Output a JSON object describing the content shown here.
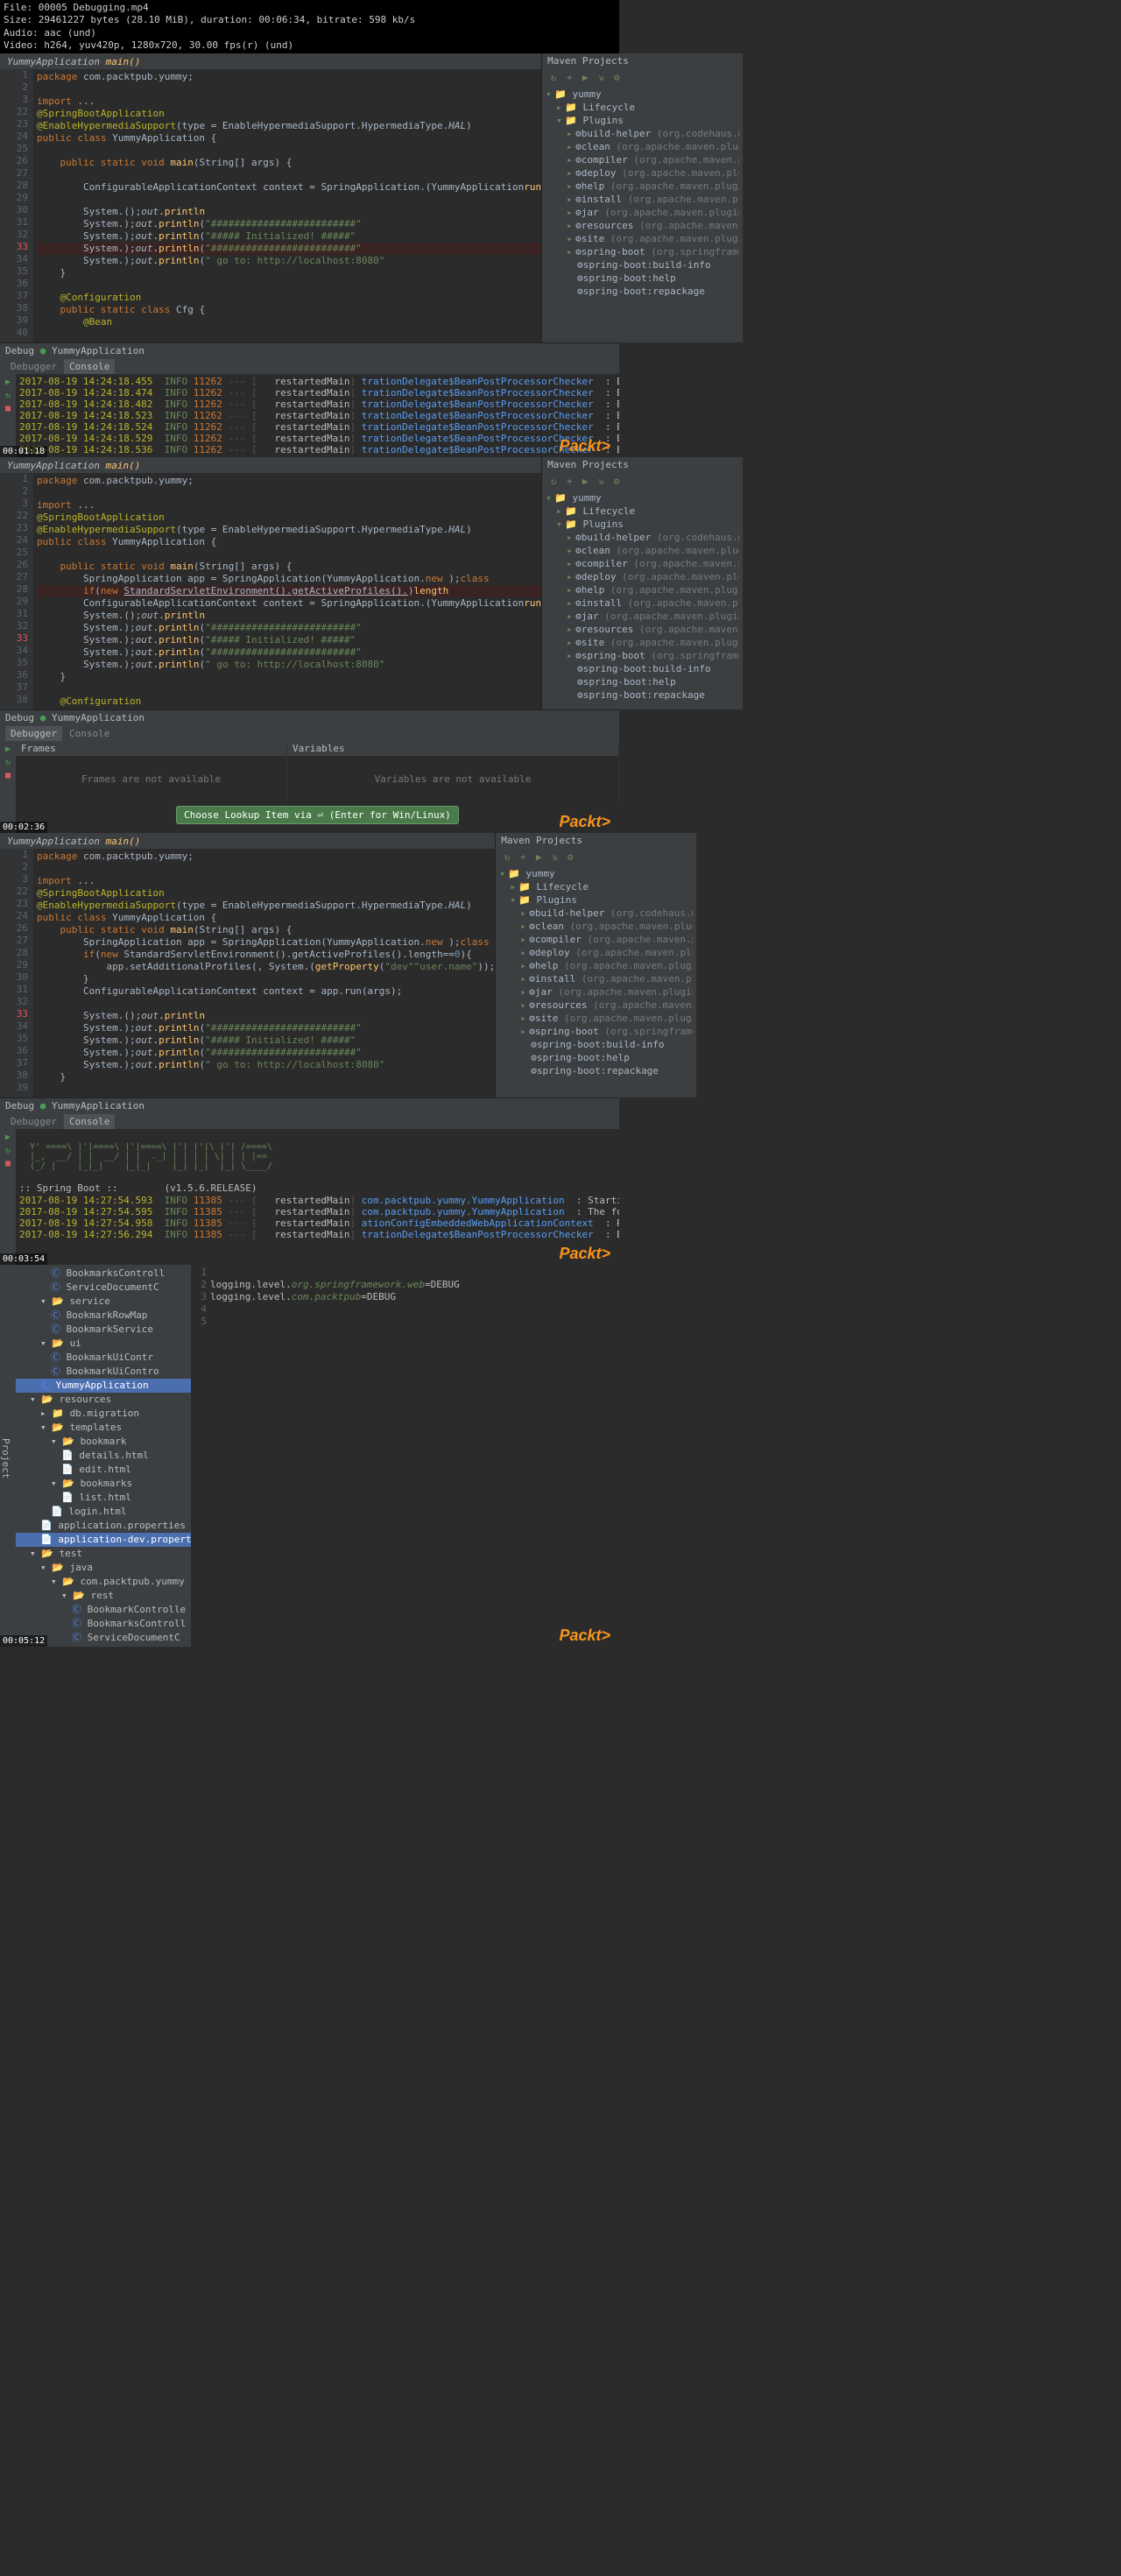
{
  "file_info": {
    "file": "File: 00005 Debugging.mp4",
    "size": "Size: 29461227 bytes (28.10 MiB), duration: 00:06:34, bitrate: 598 kb/s",
    "audio": "Audio: aac (und)",
    "video": "Video: h264, yuv420p, 1280x720, 30.00 fps(r) (und)"
  },
  "tab": {
    "class": "YummyApplication",
    "method": "main()"
  },
  "maven_title": "Maven Projects",
  "maven_tree": {
    "root": "yummy",
    "lifecycle": "Lifecycle",
    "plugins": "Plugins",
    "items": [
      {
        "n": "build-helper",
        "d": " (org.codehaus.mojo:b"
      },
      {
        "n": "clean",
        "d": " (org.apache.maven.plugins:"
      },
      {
        "n": "compiler",
        "d": " (org.apache.maven.plug"
      },
      {
        "n": "deploy",
        "d": " (org.apache.maven.plugins"
      },
      {
        "n": "help",
        "d": " (org.apache.maven.plugins:m"
      },
      {
        "n": "install",
        "d": " (org.apache.maven.plugins"
      },
      {
        "n": "jar",
        "d": " (org.apache.maven.plugins:ma"
      },
      {
        "n": "resources",
        "d": " (org.apache.maven.plu"
      },
      {
        "n": "site",
        "d": " (org.apache.maven.plugins:m"
      },
      {
        "n": "spring-boot",
        "d": " (org.springframework"
      }
    ],
    "sb_items": [
      "spring-boot:build-info",
      "spring-boot:help",
      "spring-boot:repackage"
    ]
  },
  "code1": [
    {
      "g": "1",
      "t": "package ",
      "kw": true,
      "r": "com.packtpub.yummy;"
    },
    {
      "g": "2",
      "t": ""
    },
    {
      "g": "3",
      "t": "import ",
      "kw": true,
      "r": "..."
    },
    {
      "g": "22",
      "t": "@SpringBootApplication",
      "ann": true
    },
    {
      "g": "23",
      "t": "@EnableHypermediaSupport",
      "ann": true,
      "r": "(type = EnableHypermediaSupport.HypermediaType.",
      "r2": "HAL",
      "r3": ")"
    },
    {
      "g": "24",
      "t": "public class ",
      "kw": true,
      "r": "YummyApplication {"
    },
    {
      "g": "25",
      "t": ""
    },
    {
      "g": "26",
      "t": "    public static void ",
      "kw": true,
      "m": "main",
      "r": "(String[] args) {"
    },
    {
      "g": "27",
      "t": ""
    },
    {
      "g": "28",
      "t": "        ConfigurableApplicationContext context = SpringApplication.",
      "m": "run",
      "r": "(YummyApplication"
    },
    {
      "g": "29",
      "t": ""
    },
    {
      "g": "30",
      "t": "        System.",
      "s": "out",
      "m": ".println",
      "r": "();"
    },
    {
      "g": "31",
      "t": "        System.",
      "s": "out",
      "m": ".println",
      "str": "\"#########################\"",
      "r2": ");"
    },
    {
      "g": "32",
      "t": "        System.",
      "s": "out",
      "m": ".println",
      "str": "\"##### Initialized! #####\"",
      "r2": ");"
    },
    {
      "g": "33",
      "bp": true,
      "t": "        System.",
      "s": "out",
      "m": ".println",
      "str": "\"#########################\"",
      "r2": ");",
      "hl": true
    },
    {
      "g": "34",
      "t": "        System.",
      "s": "out",
      "m": ".println",
      "str": "\" go to: http://localhost:8080\"",
      "r2": ");"
    },
    {
      "g": "35",
      "t": "    }"
    },
    {
      "g": "36",
      "t": ""
    },
    {
      "g": "37",
      "t": "    @Configuration",
      "ann": true
    },
    {
      "g": "38",
      "t": "    public static class ",
      "kw": true,
      "r": "Cfg {"
    },
    {
      "g": "39",
      "t": "        @Bean",
      "ann": true
    },
    {
      "g": "40",
      "t": ""
    }
  ],
  "debug_title": "Debug",
  "debug_app": "YummyApplication",
  "console_tabs": {
    "debugger": "Debugger",
    "console": "Console"
  },
  "log1": [
    {
      "ts": "2017-08-19 14:24:18.455",
      "lvl": "INFO",
      "pid": "11262",
      "th": "restartedMain",
      "cls": "trationDelegate$BeanPostProcessorChecker",
      "msg": ": Bean 'org.springframework.s"
    },
    {
      "ts": "2017-08-19 14:24:18.474",
      "lvl": "INFO",
      "pid": "11262",
      "th": "restartedMain",
      "cls": "trationDelegate$BeanPostProcessorChecker",
      "msg": ": Bean 'org.springframework.t"
    },
    {
      "ts": "2017-08-19 14:24:18.482",
      "lvl": "INFO",
      "pid": "11262",
      "th": "restartedMain",
      "cls": "trationDelegate$BeanPostProcessorChecker",
      "msg": ": Bean 'yummyApplication.Cfg'"
    },
    {
      "ts": "2017-08-19 14:24:18.523",
      "lvl": "INFO",
      "pid": "11262",
      "th": "restartedMain",
      "cls": "trationDelegate$BeanPostProcessorChecker",
      "msg": ": Bean 'objectPostProcessor'"
    },
    {
      "ts": "2017-08-19 14:24:18.524",
      "lvl": "INFO",
      "pid": "11262",
      "th": "restartedMain",
      "cls": "trationDelegate$BeanPostProcessorChecker",
      "msg": ": Bean 'org.springframework.s"
    },
    {
      "ts": "2017-08-19 14:24:18.529",
      "lvl": "INFO",
      "pid": "11262",
      "th": "restartedMain",
      "cls": "trationDelegate$BeanPostProcessorChecker",
      "msg": ": Bean 'org.springframework.s"
    },
    {
      "ts": "2017-08-19 14:24:18.536",
      "lvl": "INFO",
      "pid": "11262",
      "th": "restartedMain",
      "cls": "trationDelegate$BeanPostProcessorChecker",
      "msg": ": Bean 'methodSecurityMetada"
    }
  ],
  "ts1": "00:01:18",
  "packt": "Packt>",
  "code2": [
    {
      "g": "1",
      "t": "package ",
      "kw": true,
      "r": "com.packtpub.yummy;"
    },
    {
      "g": "2",
      "t": ""
    },
    {
      "g": "3",
      "t": "import ",
      "kw": true,
      "r": "..."
    },
    {
      "g": "22",
      "t": "@SpringBootApplication",
      "ann": true
    },
    {
      "g": "23",
      "t": "@EnableHypermediaSupport",
      "ann": true,
      "r": "(type = EnableHypermediaSupport.HypermediaType.",
      "r2": "HAL",
      "r3": ")"
    },
    {
      "g": "24",
      "t": "public class ",
      "kw": true,
      "r": "YummyApplication {"
    },
    {
      "g": "25",
      "t": ""
    },
    {
      "g": "26",
      "t": "    public static void ",
      "kw": true,
      "m": "main",
      "r": "(String[] args) {"
    },
    {
      "g": "27",
      "t": "        SpringApplication app = ",
      "kw2": "new ",
      "r": "SpringApplication(YummyApplication.",
      "kw3": "class",
      "r2": ");"
    },
    {
      "g": "28",
      "t": "        ",
      "kw": "if",
      "r": "(",
      "kw2": "new ",
      "u": "StandardServletEnvironment().getActiveProfiles().",
      "m": "length",
      "hl": true,
      "r2": ")"
    },
    {
      "g": "29",
      "t": "        ConfigurableApplicationContext context = SpringApplication.",
      "m": "run",
      "r": "(YummyApplication"
    },
    {
      "g": "31",
      "t": "        System.",
      "s": "out",
      "m": ".println",
      "r": "();"
    },
    {
      "g": "32",
      "t": "        System.",
      "s": "out",
      "m": ".println",
      "str": "\"#########################\"",
      "r2": ");"
    },
    {
      "g": "33",
      "bp": true,
      "t": "        System.",
      "s": "out",
      "m": ".println",
      "str": "\"##### Initialized! #####\"",
      "r2": ");"
    },
    {
      "g": "34",
      "t": "        System.",
      "s": "out",
      "m": ".println",
      "str": "\"#########################\"",
      "r2": ");"
    },
    {
      "g": "35",
      "t": "        System.",
      "s": "out",
      "m": ".println",
      "str": "\" go to: http://localhost:8080\"",
      "r2": ");"
    },
    {
      "g": "36",
      "t": "    }"
    },
    {
      "g": "37",
      "t": ""
    },
    {
      "g": "38",
      "t": "    @Configuration",
      "ann": true
    }
  ],
  "frames_title": "Frames",
  "vars_title": "Variables",
  "frames_na": "Frames are not available",
  "vars_na": "Variables are not available",
  "lookup_popup": "Choose Lookup Item via ⏎ (Enter for Win/Linux)",
  "ts2": "00:02:36",
  "code3": [
    {
      "g": "1",
      "t": "package ",
      "kw": true,
      "r": "com.packtpub.yummy;"
    },
    {
      "g": "2",
      "t": ""
    },
    {
      "g": "3",
      "t": "import ",
      "kw": true,
      "r": "..."
    },
    {
      "g": "22",
      "t": "@SpringBootApplication",
      "ann": true
    },
    {
      "g": "23",
      "t": "@EnableHypermediaSupport",
      "ann": true,
      "r": "(type = EnableHypermediaSupport.HypermediaType.",
      "r2": "HAL",
      "r3": ")"
    },
    {
      "g": "24",
      "t": "public class ",
      "kw": true,
      "r": "YummyApplication {"
    },
    {
      "g": "26",
      "t": "    public static void ",
      "kw": true,
      "m": "main",
      "r": "(String[] args) {"
    },
    {
      "g": "27",
      "t": "        SpringApplication app = ",
      "kw2": "new ",
      "r": "SpringApplication(YummyApplication.",
      "kw3": "class",
      "r2": ");"
    },
    {
      "g": "28",
      "t": "        ",
      "kw": "if",
      "r": "(",
      "kw2": "new ",
      "r2": "StandardServletEnvironment().getActiveProfiles().length==",
      "num": "0",
      "r3": "){"
    },
    {
      "g": "29",
      "t": "            app.setAdditionalProfiles(",
      "str": "\"dev\"",
      "r": ", System.",
      "m": "getProperty",
      "r2": "(",
      "str2": "\"user.name\"",
      "r3": "));"
    },
    {
      "g": "30",
      "t": "        }"
    },
    {
      "g": "31",
      "t": "        ConfigurableApplicationContext context = app.run(args);"
    },
    {
      "g": "32",
      "t": ""
    },
    {
      "g": "33",
      "bp": true,
      "t": "        System.",
      "s": "out",
      "m": ".println",
      "r": "();"
    },
    {
      "g": "34",
      "t": "        System.",
      "s": "out",
      "m": ".println",
      "str": "\"#########################\"",
      "r2": ");"
    },
    {
      "g": "35",
      "t": "        System.",
      "s": "out",
      "m": ".println",
      "str": "\"##### Initialized! #####\"",
      "r2": ");"
    },
    {
      "g": "36",
      "t": "        System.",
      "s": "out",
      "m": ".println",
      "str": "\"#########################\"",
      "r2": ");"
    },
    {
      "g": "37",
      "t": "        System.",
      "s": "out",
      "m": ".println",
      "str": "\" go to: http://localhost:8080\"",
      "r2": ");"
    },
    {
      "g": "38",
      "t": "    }"
    },
    {
      "g": "39",
      "t": ""
    }
  ],
  "banner": ":: Spring Boot ::        (v1.5.6.RELEASE)",
  "log3": [
    {
      "ts": "2017-08-19 14:27:54.593",
      "lvl": "INFO",
      "pid": "11385",
      "th": "restartedMain",
      "cls": "com.packtpub.yummy.YummyApplication",
      "msg": ": Starting YummyApplication o"
    },
    {
      "ts": "2017-08-19 14:27:54.595",
      "lvl": "INFO",
      "pid": "11385",
      "th": "restartedMain",
      "cls": "com.packtpub.yummy.YummyApplication",
      "msg": ": The following profiles are"
    },
    {
      "ts": "2017-08-19 14:27:54.958",
      "lvl": "INFO",
      "pid": "11385",
      "th": "restartedMain",
      "cls": "ationConfigEmbeddedWebApplicationContext",
      "msg": ": Refreshing org.springframew"
    },
    {
      "ts": "2017-08-19 14:27:56.294",
      "lvl": "INFO",
      "pid": "11385",
      "th": "restartedMain",
      "cls": "trationDelegate$BeanPostProcessorChecker",
      "msg": ": Bean 'yummyApplication.Cfg'"
    }
  ],
  "ts3": "00:03:54",
  "project_title": "Project",
  "project_tree": [
    {
      "i": 3,
      "t": "BookmarksControll",
      "c": "cls"
    },
    {
      "i": 3,
      "t": "ServiceDocumentC",
      "c": "cls"
    },
    {
      "i": 2,
      "t": "service",
      "c": "open"
    },
    {
      "i": 3,
      "t": "BookmarkRowMap",
      "c": "cls"
    },
    {
      "i": 3,
      "t": "BookmarkService",
      "c": "cls"
    },
    {
      "i": 2,
      "t": "ui",
      "c": "open"
    },
    {
      "i": 3,
      "t": "BookmarkUiContr",
      "c": "cls"
    },
    {
      "i": 3,
      "t": "BookmarkUiContro",
      "c": "cls"
    },
    {
      "i": 2,
      "t": "YummyApplication",
      "c": "cls",
      "sel": true
    },
    {
      "i": 1,
      "t": "resources",
      "c": "open"
    },
    {
      "i": 2,
      "t": "db.migration",
      "c": "folder"
    },
    {
      "i": 2,
      "t": "templates",
      "c": "open"
    },
    {
      "i": 3,
      "t": "bookmark",
      "c": "open"
    },
    {
      "i": 4,
      "t": "details.html",
      "c": "file"
    },
    {
      "i": 4,
      "t": "edit.html",
      "c": "file"
    },
    {
      "i": 3,
      "t": "bookmarks",
      "c": "open"
    },
    {
      "i": 4,
      "t": "list.html",
      "c": "file"
    },
    {
      "i": 3,
      "t": "login.html",
      "c": "file"
    },
    {
      "i": 2,
      "t": "application.properties",
      "c": "file"
    },
    {
      "i": 2,
      "t": "application-dev.properties",
      "c": "file",
      "sel": true
    },
    {
      "i": 1,
      "t": "test",
      "c": "open"
    },
    {
      "i": 2,
      "t": "java",
      "c": "open"
    },
    {
      "i": 3,
      "t": "com.packtpub.yummy",
      "c": "open"
    },
    {
      "i": 4,
      "t": "rest",
      "c": "open"
    },
    {
      "i": 5,
      "t": "BookmarkControlle",
      "c": "cls"
    },
    {
      "i": 5,
      "t": "BookmarksControll",
      "c": "cls"
    },
    {
      "i": 5,
      "t": "ServiceDocumentC",
      "c": "cls"
    }
  ],
  "props": [
    {
      "g": "1",
      "t": ""
    },
    {
      "g": "2",
      "k": "logging.level.",
      "c": "org.springframework.web",
      "v": "=DEBUG"
    },
    {
      "g": "3",
      "k": "logging.level.",
      "c": "com.packtpub",
      "v": "=DEBUG"
    },
    {
      "g": "4",
      "t": ""
    },
    {
      "g": "5",
      "t": ""
    }
  ],
  "ts4": "00:05:12"
}
